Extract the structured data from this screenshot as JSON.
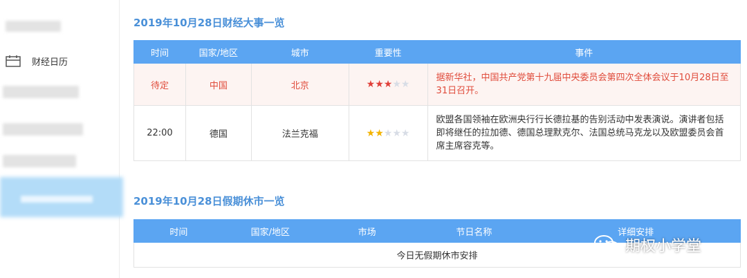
{
  "sidebar": {
    "calendar_label": "财经日历"
  },
  "events_section": {
    "title": "2019年10月28日财经大事一览",
    "headers": [
      "时间",
      "国家/地区",
      "城市",
      "重要性",
      "事件"
    ],
    "rows": [
      {
        "time": "待定",
        "country": "中国",
        "city": "北京",
        "importance": 3,
        "event": "据新华社，中国共产党第十九届中央委员会第四次全体会议于10月28日至31日召开。"
      },
      {
        "time": "22:00",
        "country": "德国",
        "city": "法兰克福",
        "importance": 2,
        "event": "欧盟各国领袖在欧洲央行行长德拉基的告别活动中发表演说。演讲者包括即将继任的拉加德、德国总理默克尔、法国总统马克龙以及欧盟委员会首席主席容克等。"
      }
    ]
  },
  "holiday_section": {
    "title": "2019年10月28日假期休市一览",
    "headers": [
      "时间",
      "国家/地区",
      "市场",
      "节日名称",
      "详细安排"
    ],
    "empty_text": "今日无假期休市安排"
  },
  "watermark": {
    "text": "期权小学堂"
  },
  "colors": {
    "accent": "#5ba5f2",
    "title": "#4a90d8",
    "highlight_text": "#e04b3b"
  }
}
